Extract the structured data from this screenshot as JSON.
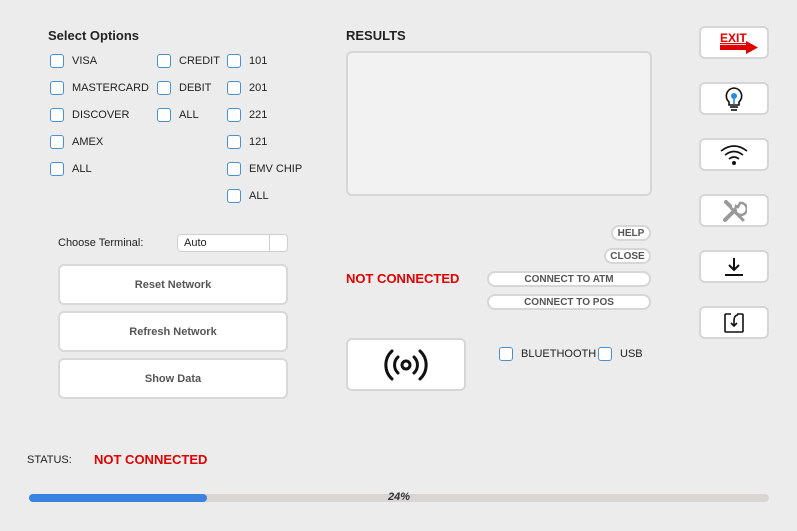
{
  "options": {
    "title": "Select Options",
    "cards": [
      "VISA",
      "MASTERCARD",
      "DISCOVER",
      "AMEX",
      "ALL"
    ],
    "types": [
      "CREDIT",
      "DEBIT",
      "ALL"
    ],
    "codes": [
      "101",
      "201",
      "221",
      "121",
      "EMV CHIP",
      "ALL"
    ]
  },
  "results": {
    "title": "RESULTS"
  },
  "terminal": {
    "label": "Choose Terminal:",
    "value": "Auto"
  },
  "buttons": {
    "reset": "Reset Network",
    "refresh": "Refresh Network",
    "show": "Show Data"
  },
  "connection": {
    "status": "NOT CONNECTED",
    "help": "HELP",
    "close": "CLOSE",
    "atm": "CONNECT TO ATM",
    "pos": "CONNECT TO POS",
    "bluetooth": "BLUETHOOTH",
    "usb": "USB"
  },
  "sidebar": {
    "exit": "EXIT",
    "icons": [
      "exit-icon",
      "lightbulb-icon",
      "wifi-icon",
      "tools-icon",
      "download-icon",
      "import-icon"
    ]
  },
  "status": {
    "label": "STATUS:",
    "value": "NOT CONNECTED"
  },
  "progress": {
    "percent": 24,
    "label": "24%"
  },
  "colors": {
    "accent": "#3a84e0",
    "alert": "#e00000",
    "exit": "#e00000"
  }
}
